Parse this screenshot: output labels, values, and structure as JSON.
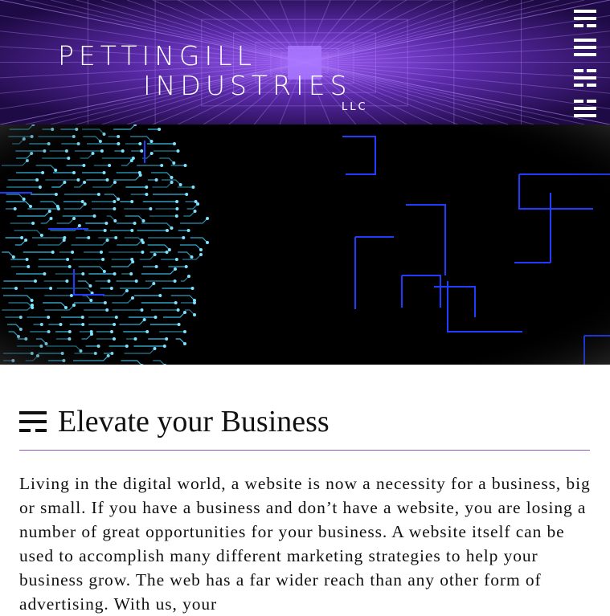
{
  "brand": {
    "name_line1": "PETTINGILL",
    "name_line2": "INDUSTRIES",
    "suffix": "LLC"
  },
  "menu": {
    "icon": "hamburger-menu-icon"
  },
  "hero": {
    "image": "circuit-board-head-illustration"
  },
  "section": {
    "icon": "trigram-icon",
    "title": "Elevate your Business",
    "paragraph": "Living in the digital world, a website is now a necessity for a business, big or small. If you have a business and don’t have a website, you are losing a number of great opportunities for your business. A website itself can be used to accomplish many different marketing strategies to help your business grow. The web has a far wider reach than any other form of advertising. With us, your"
  },
  "colors": {
    "header_bg": "#2b0f5a",
    "accent_purple": "#8a5ab8",
    "circuit_cyan": "#3ec6f0",
    "circuit_blue": "#1f3cff",
    "text": "#111111"
  }
}
